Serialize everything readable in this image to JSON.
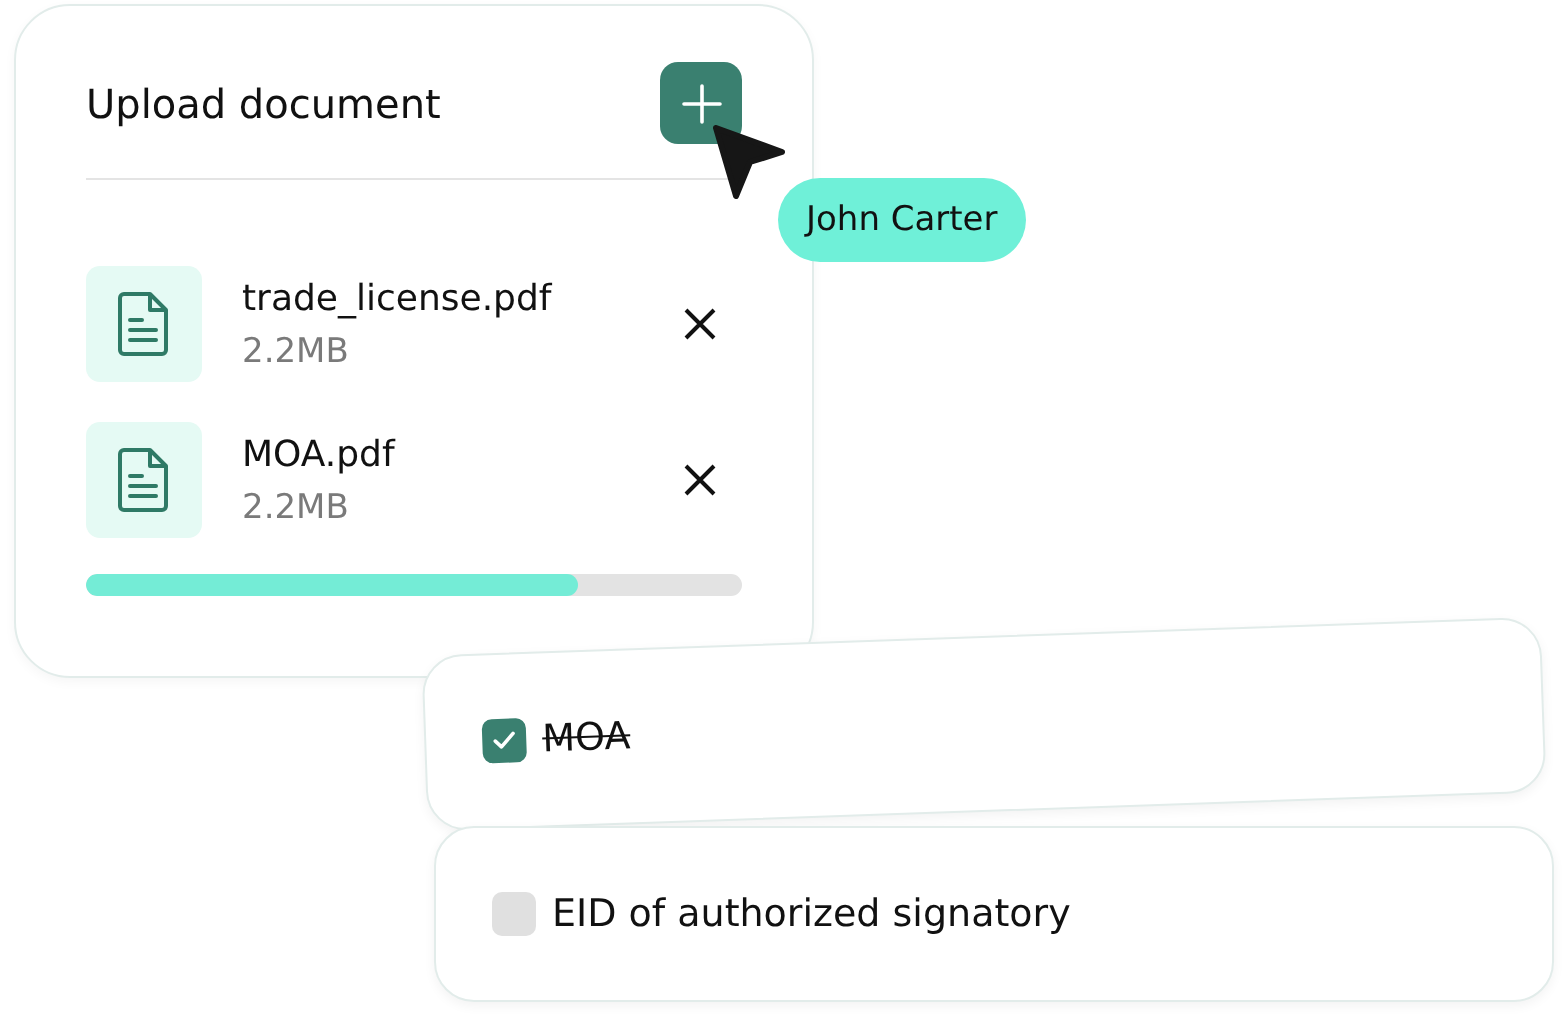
{
  "upload": {
    "title": "Upload document",
    "files": [
      {
        "name": "trade_license.pdf",
        "size": "2.2MB"
      },
      {
        "name": "MOA.pdf",
        "size": "2.2MB"
      }
    ],
    "progress": {
      "level": 0.75
    }
  },
  "cursor": {
    "label": "John Carter"
  },
  "checklist": [
    {
      "label": "MOA",
      "checked": true
    },
    {
      "label": "EID of authorized signatory",
      "checked": false
    }
  ]
}
